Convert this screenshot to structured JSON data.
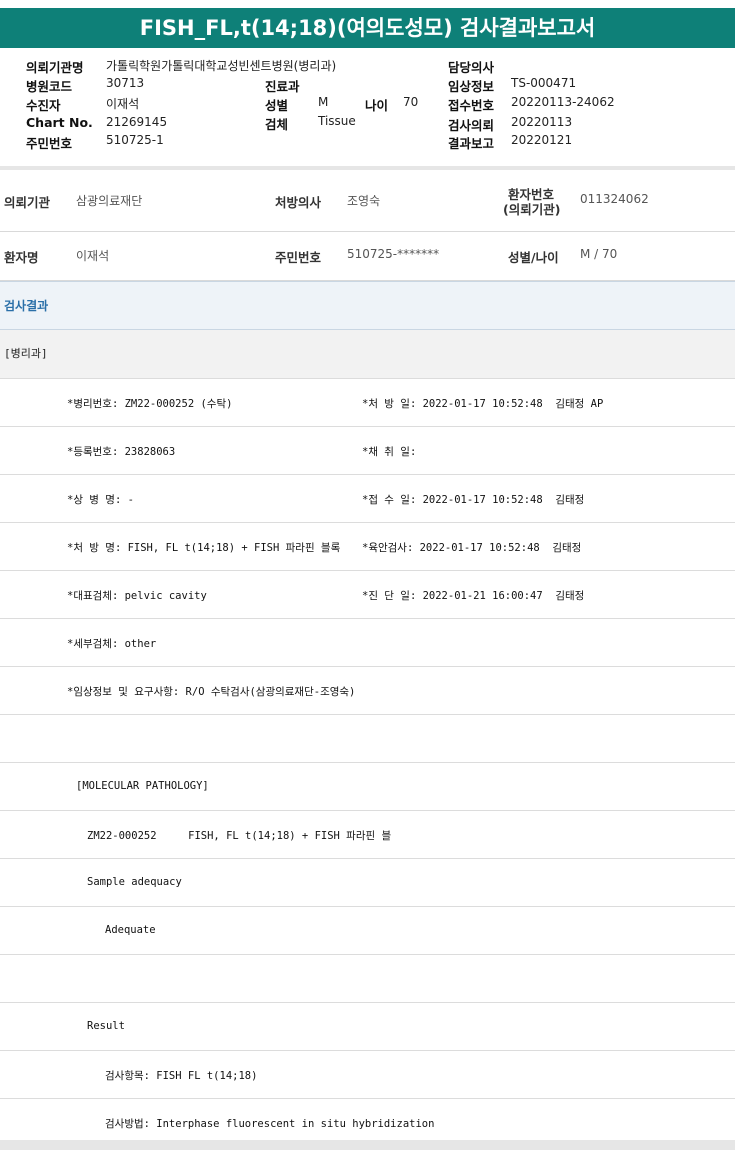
{
  "title": "FISH_FL,t(14;18)(여의도성모) 검사결과보고서",
  "header": {
    "institution_label": "의뢰기관명",
    "institution_value": "가톨릭학원가톨릭대학교성빈센트병원(병리과)",
    "doctor_label": "담당의사",
    "doctor_value": "",
    "hospital_code_label": "병원코드",
    "hospital_code_value": "30713",
    "department_label": "진료과",
    "department_value": "",
    "clinical_info_label": "임상정보",
    "clinical_info_value": "TS-000471",
    "patient_label": "수진자",
    "patient_value": "이재석",
    "sex_label": "성별",
    "sex_value": "M",
    "age_label": "나이",
    "age_value": "70",
    "receipt_label": "접수번호",
    "receipt_value": "20220113-24062",
    "chart_label": "Chart No.",
    "chart_value": "21269145",
    "specimen_label": "검체",
    "specimen_value": "Tissue",
    "request_label": "검사의뢰",
    "request_value": "20220113",
    "rrn_label": "주민번호",
    "rrn_value": "510725-1",
    "report_label": "결과보고",
    "report_value": "20220121"
  },
  "info": {
    "req_inst_label": "의뢰기관",
    "req_inst_value": "삼광의료재단",
    "prescriber_label": "처방의사",
    "prescriber_value": "조영숙",
    "patient_no_label_1": "환자번호",
    "patient_no_label_2": "(의뢰기관)",
    "patient_no_value": "011324062",
    "name_label": "환자명",
    "name_value": "이재석",
    "rrn_label": "주민번호",
    "rrn_value": "510725-*******",
    "sexage_label": "성별/나이",
    "sexage_value": "M / 70"
  },
  "section_title": "검사결과",
  "sub_title": "[병리과]",
  "rows": {
    "r1a": "*병리번호: ZM22-000252 (수탁)",
    "r1b": "*처 방 일: 2022-01-17 10:52:48  김태정 AP",
    "r2a": "*등록번호: 23828063",
    "r2b": "*채 취 일:",
    "r3a": "*상 병 명: -",
    "r3b": "*접 수 일: 2022-01-17 10:52:48  김태정",
    "r4a": "*처 방 명: FISH, FL t(14;18) + FISH 파라핀 블록",
    "r4b": "*육안검사: 2022-01-17 10:52:48  김태정",
    "r5a": "*대표검체: pelvic cavity",
    "r5b": "*진 단 일: 2022-01-21 16:00:47  김태정",
    "r6a": "*세부검체: other",
    "r7a": "*임상정보 및 요구사항: R/O 수탁검사(삼광의료재단-조영숙)",
    "r9a": "[MOLECULAR PATHOLOGY]",
    "r10a": "ZM22-000252     FISH, FL t(14;18) + FISH 파라핀 블",
    "r11a": "Sample adequacy",
    "r12a": "Adequate",
    "r14a": "Result",
    "r15a": "검사항목: FISH FL t(14;18)",
    "r16a": "검사방법: Interphase fluorescent in situ hybridization"
  }
}
